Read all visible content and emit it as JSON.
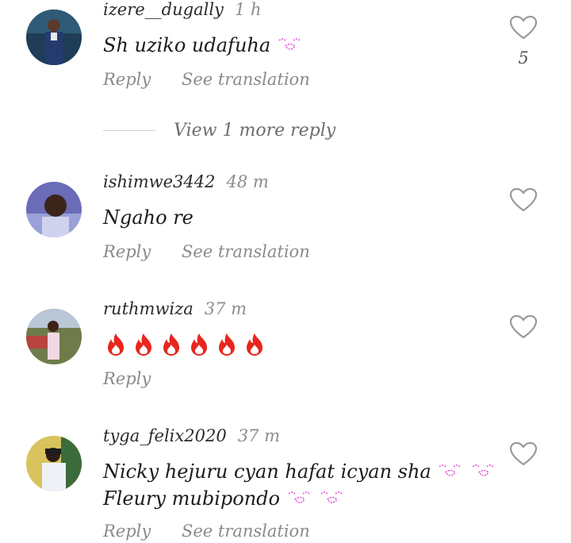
{
  "comments": [
    {
      "username": "izere__dugally",
      "time": "1 h",
      "text": "Sh uziko udafuha",
      "emoji": "kissing-face-icon",
      "reply": "Reply",
      "see_translation": "See translation",
      "likes": "5"
    },
    {
      "username": "ishimwe3442",
      "time": "48 m",
      "text": "Ngaho re",
      "reply": "Reply",
      "see_translation": "See translation"
    },
    {
      "username": "ruthmwiza",
      "time": "37 m",
      "text": "",
      "emoji": "fire-icon",
      "emoji_count": 6,
      "reply": "Reply"
    },
    {
      "username": "tyga_felix2020",
      "time": "37 m",
      "text_line1": "Nicky hejuru cyan hafat icyan sha",
      "text_line2": "Fleury mubipondo",
      "emoji": "kissing-face-icon",
      "reply": "Reply",
      "see_translation": "See translation"
    }
  ],
  "view_more": {
    "label": "View 1 more reply"
  },
  "colors": {
    "text": "#1c1c1c",
    "secondary": "#8a8a8a",
    "heart_outline": "#9a9a9a",
    "fire": "#e8261d",
    "kiss_emoji": "#e24bd8"
  }
}
